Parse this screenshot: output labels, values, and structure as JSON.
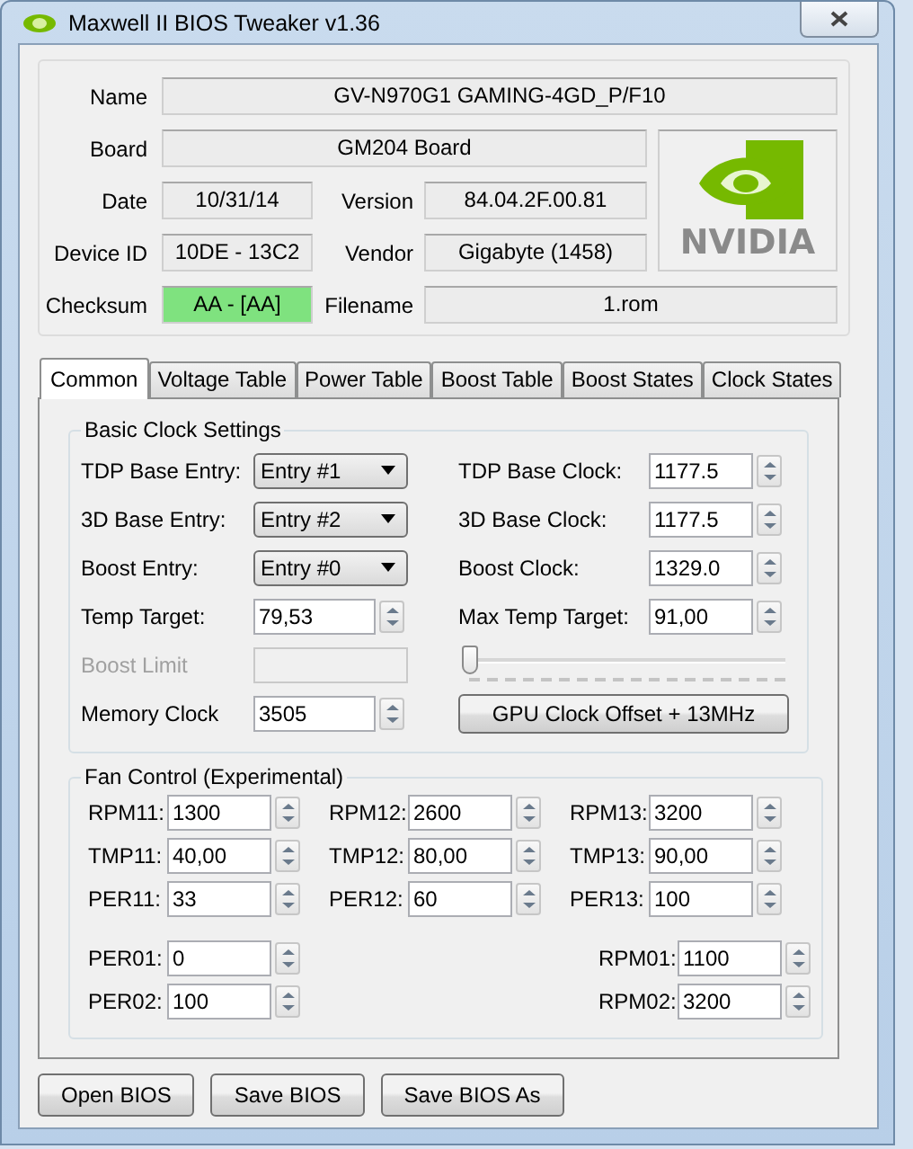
{
  "window": {
    "title": "Maxwell II BIOS Tweaker v1.36"
  },
  "header": {
    "name": {
      "label": "Name",
      "value": "GV-N970G1 GAMING-4GD_P/F10"
    },
    "board": {
      "label": "Board",
      "value": "GM204 Board"
    },
    "date": {
      "label": "Date",
      "value": "10/31/14"
    },
    "version": {
      "label": "Version",
      "value": "84.04.2F.00.81"
    },
    "device_id": {
      "label": "Device ID",
      "value": "10DE - 13C2"
    },
    "vendor": {
      "label": "Vendor",
      "value": "Gigabyte (1458)"
    },
    "checksum": {
      "label": "Checksum",
      "value": "AA - [AA]",
      "valid": true
    },
    "filename": {
      "label": "Filename",
      "value": "1.rom"
    },
    "logo_text": "NVIDIA"
  },
  "tabs": [
    {
      "label": "Common",
      "selected": true
    },
    {
      "label": "Voltage Table",
      "selected": false
    },
    {
      "label": "Power Table",
      "selected": false
    },
    {
      "label": "Boost Table",
      "selected": false
    },
    {
      "label": "Boost States",
      "selected": false
    },
    {
      "label": "Clock States",
      "selected": false
    }
  ],
  "basic_clock": {
    "title": "Basic Clock Settings",
    "left": [
      {
        "label": "TDP Base Entry:",
        "kind": "dropdown",
        "value": "Entry #1",
        "disabled": false
      },
      {
        "label": "3D Base Entry:",
        "kind": "dropdown",
        "value": "Entry #2",
        "disabled": false
      },
      {
        "label": "Boost Entry:",
        "kind": "dropdown",
        "value": "Entry #0",
        "disabled": false
      },
      {
        "label": "Temp Target:",
        "kind": "spin",
        "value": "79,53",
        "disabled": false
      },
      {
        "label": "Boost Limit",
        "kind": "text",
        "disabled": true
      },
      {
        "label": "Memory Clock",
        "kind": "spin",
        "value": "3505",
        "disabled": false
      }
    ],
    "right": [
      {
        "label": "TDP Base Clock:",
        "value": "1177.5"
      },
      {
        "label": "3D Base Clock:",
        "value": "1177.5"
      },
      {
        "label": "Boost Clock:",
        "value": "1329.0"
      },
      {
        "label": "Max Temp Target:",
        "value": "91,00"
      }
    ],
    "slider": {
      "level": 0
    },
    "offset_button": "GPU Clock Offset + 13MHz"
  },
  "fan_control": {
    "title": "Fan Control (Experimental)",
    "rows": [
      [
        {
          "label": "RPM11:",
          "value": "1300"
        },
        {
          "label": "RPM12:",
          "value": "2600"
        },
        {
          "label": "RPM13:",
          "value": "3200"
        }
      ],
      [
        {
          "label": "TMP11:",
          "value": "40,00"
        },
        {
          "label": "TMP12:",
          "value": "80,00"
        },
        {
          "label": "TMP13:",
          "value": "90,00"
        }
      ],
      [
        {
          "label": "PER11:",
          "value": "33"
        },
        {
          "label": "PER12:",
          "value": "60"
        },
        {
          "label": "PER13:",
          "value": "100"
        }
      ]
    ],
    "left_extra": [
      {
        "label": "PER01:",
        "value": "0"
      },
      {
        "label": "PER02:",
        "value": "100"
      }
    ],
    "right_extra": [
      {
        "label": "RPM01:",
        "value": "1100"
      },
      {
        "label": "RPM02:",
        "value": "3200"
      }
    ]
  },
  "buttons": [
    "Open BIOS",
    "Save BIOS",
    "Save BIOS As"
  ]
}
